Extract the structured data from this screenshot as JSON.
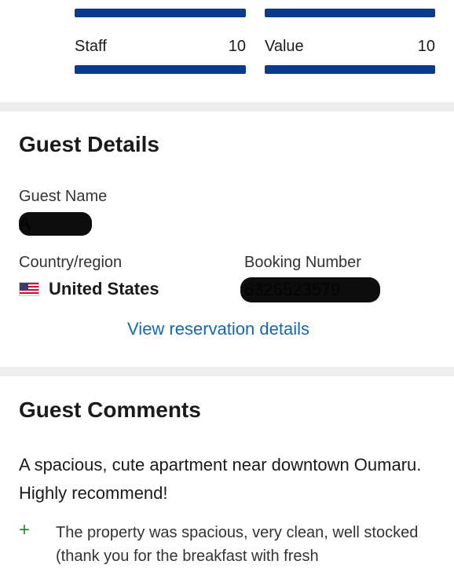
{
  "ratings": {
    "left": {
      "label": "Staff",
      "value": "10"
    },
    "right": {
      "label": "Value",
      "value": "10"
    },
    "bar_color": "#0a3a8c"
  },
  "guest_details": {
    "title": "Guest Details",
    "guest_name_label": "Guest Name",
    "guest_name_value": "A",
    "country_label": "Country/region",
    "country_value": "United States",
    "country_flag": "us-flag-icon",
    "booking_label": "Booking Number",
    "booking_value": "6326523579",
    "link_label": "View reservation details",
    "link_color": "#1466b8"
  },
  "guest_comments": {
    "title": "Guest Comments",
    "headline": "A spacious, cute apartment near downtown Oumaru. Highly recommend!",
    "positive_icon": "plus-icon",
    "positive_text": "The property was spacious, very clean, well stocked (thank you for the breakfast with fresh"
  }
}
